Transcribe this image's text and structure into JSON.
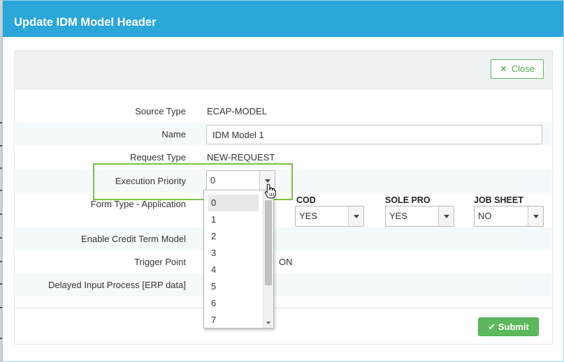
{
  "modal": {
    "title": "Update IDM Model Header"
  },
  "toolbar": {
    "close_label": "Close",
    "close_icon": "close-icon",
    "submit_label": "Submit",
    "submit_icon": "check-icon"
  },
  "form": {
    "source_type": {
      "label": "Source Type",
      "value": "ECAP-MODEL"
    },
    "name": {
      "label": "Name",
      "value": "IDM Model 1"
    },
    "request_type": {
      "label": "Request Type",
      "value": "NEW-REQUEST"
    },
    "execution_priority": {
      "label": "Execution Priority",
      "value": "0"
    },
    "form_type": {
      "label": "Form Type - Application"
    },
    "cod": {
      "header": "COD",
      "value": "YES"
    },
    "sole_pro": {
      "header": "SOLE PRO",
      "value": "YES"
    },
    "job_sheet": {
      "header": "JOB SHEET",
      "value": "NO"
    },
    "credit_term": {
      "label": "Enable Credit Term Model"
    },
    "trigger_point": {
      "label": "Trigger Point",
      "value_partial": "ON"
    },
    "delayed_input": {
      "label": "Delayed Input Process [ERP data]"
    }
  },
  "priority_options": [
    "0",
    "1",
    "2",
    "3",
    "4",
    "5",
    "6",
    "7"
  ],
  "colors": {
    "header": "#2aa6d9",
    "accent_green": "#5cb85c",
    "highlight": "#7ac143"
  }
}
